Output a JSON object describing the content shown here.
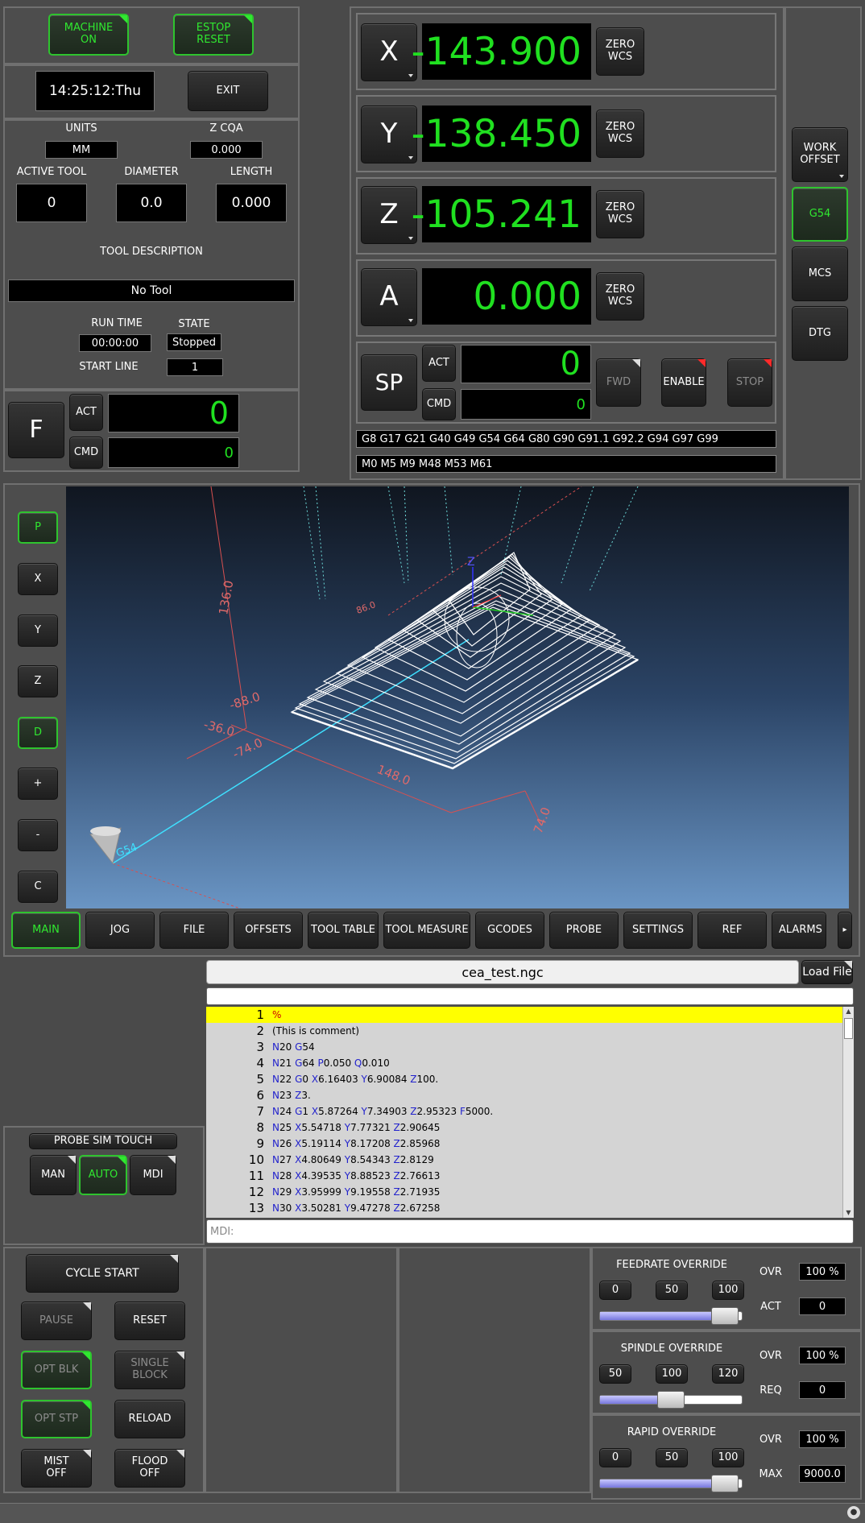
{
  "controls": {
    "machine_on": "MACHINE\nON",
    "estop_reset": "ESTOP\nRESET",
    "clock": "14:25:12:Thu",
    "exit": "EXIT"
  },
  "info": {
    "units_label": "UNITS",
    "units_value": "MM",
    "zcqa_label": "Z CQA",
    "zcqa_value": "0.000",
    "active_tool_label": "ACTIVE TOOL",
    "active_tool_value": "0",
    "diameter_label": "DIAMETER",
    "diameter_value": "0.0",
    "length_label": "LENGTH",
    "length_value": "0.000",
    "tool_desc_label": "TOOL DESCRIPTION",
    "tool_desc_value": "No Tool",
    "run_time_label": "RUN TIME",
    "run_time_value": "00:00:00",
    "state_label": "STATE",
    "state_value": "Stopped",
    "start_line_label": "START LINE",
    "start_line_value": "1"
  },
  "feed": {
    "label": "F",
    "act_label": "ACT",
    "act_value": "0",
    "cmd_label": "CMD",
    "cmd_value": "0"
  },
  "dro": [
    {
      "axis": "X",
      "value": "-143.900"
    },
    {
      "axis": "Y",
      "value": "-138.450"
    },
    {
      "axis": "Z",
      "value": "-105.241"
    },
    {
      "axis": "A",
      "value": "0.000"
    }
  ],
  "zero_wcs": "ZERO\nWCS",
  "spindle": {
    "label": "SP",
    "act_label": "ACT",
    "act_value": "0",
    "cmd_label": "CMD",
    "cmd_value": "0",
    "fwd": "FWD",
    "enable": "ENABLE",
    "stop": "STOP"
  },
  "gcodes_active": "G8 G17 G21 G40 G49 G54 G64 G80 G90 G91.1 G92.2 G94 G97 G99",
  "mcodes_active": "M0 M5 M9 M48 M53 M61",
  "offsets": {
    "work_offset": "WORK\nOFFSET",
    "g54": "G54",
    "mcs": "MCS",
    "dtg": "DTG"
  },
  "view_buttons": [
    "P",
    "X",
    "Y",
    "Z",
    "D",
    "+",
    "-",
    "C"
  ],
  "preview": {
    "labels": [
      "136.0",
      "-88.0",
      "-36.0",
      "-74.0",
      "148.0",
      "74.0",
      "Z",
      "G54",
      "86.0"
    ]
  },
  "tabs": [
    "MAIN",
    "JOG",
    "FILE",
    "OFFSETS",
    "TOOL TABLE",
    "TOOL MEASURE",
    "GCODES",
    "PROBE",
    "SETTINGS",
    "REF",
    "ALARMS"
  ],
  "file": {
    "name": "cea_test.ngc",
    "load": "Load File",
    "mdi_placeholder": "MDI:"
  },
  "code_lines": [
    {
      "n": "1",
      "t": "%"
    },
    {
      "n": "2",
      "t": "(This is comment)"
    },
    {
      "n": "3",
      "t": "N20 G54"
    },
    {
      "n": "4",
      "t": "N21 G64 P0.050 Q0.010"
    },
    {
      "n": "5",
      "t": "N22 G0 X6.16403 Y6.90084 Z100."
    },
    {
      "n": "6",
      "t": "N23 Z3."
    },
    {
      "n": "7",
      "t": "N24 G1 X5.87264 Y7.34903 Z2.95323 F5000."
    },
    {
      "n": "8",
      "t": "N25 X5.54718 Y7.77321 Z2.90645"
    },
    {
      "n": "9",
      "t": "N26 X5.19114 Y8.17208 Z2.85968"
    },
    {
      "n": "10",
      "t": "N27 X4.80649 Y8.54343 Z2.8129"
    },
    {
      "n": "11",
      "t": "N28 X4.39535 Y8.88523 Z2.76613"
    },
    {
      "n": "12",
      "t": "N29 X3.95999 Y9.19558 Z2.71935"
    },
    {
      "n": "13",
      "t": "N30 X3.50281 Y9.47278 Z2.67258"
    }
  ],
  "probe_sim": {
    "label": "PROBE SIM TOUCH",
    "man": "MAN",
    "auto": "AUTO",
    "mdi": "MDI"
  },
  "run": {
    "cycle_start": "CYCLE  START",
    "pause": "PAUSE",
    "reset": "RESET",
    "opt_blk": "OPT BLK",
    "single_block": "SINGLE\nBLOCK",
    "opt_stp": "OPT STP",
    "reload": "RELOAD",
    "mist": "MIST\nOFF",
    "flood": "FLOOD\nOFF"
  },
  "overrides": [
    {
      "title": "FEEDRATE OVERRIDE",
      "presets": [
        "0",
        "50",
        "100"
      ],
      "ovr_label": "OVR",
      "ovr_value": "100 %",
      "aux_label": "ACT",
      "aux_value": "0",
      "fraction": 0.88
    },
    {
      "title": "SPINDLE OVERRIDE",
      "presets": [
        "50",
        "100",
        "120"
      ],
      "ovr_label": "OVR",
      "ovr_value": "100 %",
      "aux_label": "REQ",
      "aux_value": "0",
      "fraction": 0.5
    },
    {
      "title": "RAPID OVERRIDE",
      "presets": [
        "0",
        "50",
        "100"
      ],
      "ovr_label": "OVR",
      "ovr_value": "100 %",
      "aux_label": "MAX",
      "aux_value": "9000.0",
      "fraction": 0.88
    }
  ],
  "colors": {
    "green": "#30e830",
    "highlight": "#ffff00",
    "axis_blue": "#2222cc"
  }
}
